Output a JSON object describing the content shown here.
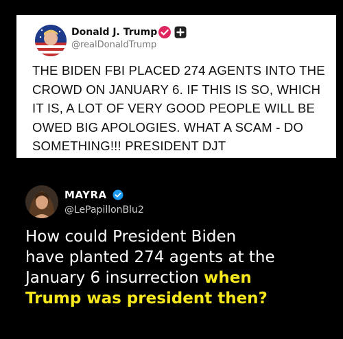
{
  "original_tweet": {
    "author_name": "Donald J. Trump",
    "author_handle": "@realDonaldTrump",
    "verified_icon": "verified-badge-icon",
    "extra_icon": "plus-square-icon",
    "lines": [
      "THE BIDEN FBI PLACED 274 AGENTS INTO THE",
      "CROWD ON JANUARY 6. IF THIS IS SO, WHICH",
      "IT IS, A LOT OF VERY GOOD PEOPLE WILL BE",
      "OWED BIG APOLOGIES. WHAT A SCAM - DO",
      "SOMETHING!!! PRESIDENT DJT"
    ]
  },
  "reply": {
    "author_name": "MAYRA",
    "author_handle": "@LePapillonBlu2",
    "verified_icon": "verified-badge-icon",
    "line1": "How could President Biden",
    "line2": "have planted 274 agents at the",
    "line3_plain": "January 6 insurrection ",
    "line3_highlight": "when",
    "line4_highlight": "Trump was president then?"
  },
  "colors": {
    "background": "#000000",
    "highlight": "#f6e81c",
    "verified_blue": "#1d9bf0",
    "verified_pink": "#e0245e"
  }
}
